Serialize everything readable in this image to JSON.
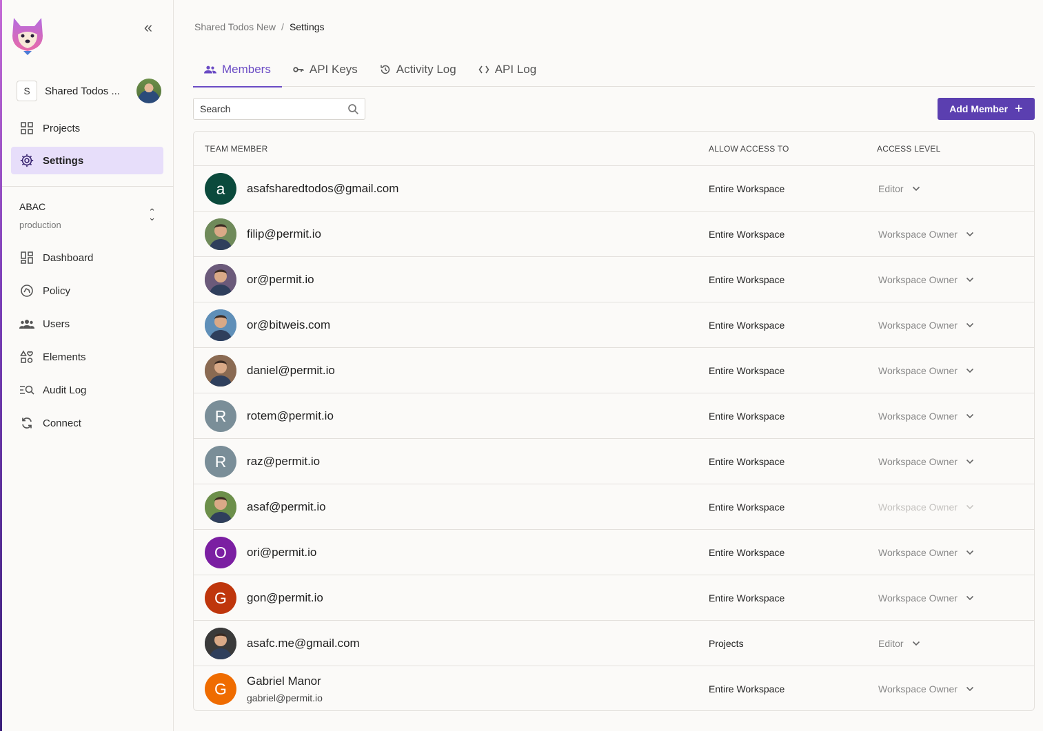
{
  "sidebar": {
    "logo": "fox-logo",
    "collapse_icon": "double-chevron-left-icon",
    "workspace": {
      "badge": "S",
      "name": "Shared Todos ..."
    },
    "top_items": [
      {
        "label": "Projects",
        "icon": "grid-icon",
        "active": false
      },
      {
        "label": "Settings",
        "icon": "gear-icon",
        "active": true
      }
    ],
    "env": {
      "name": "ABAC",
      "sub": "production"
    },
    "items": [
      {
        "label": "Dashboard",
        "icon": "dashboard-icon"
      },
      {
        "label": "Policy",
        "icon": "policy-icon"
      },
      {
        "label": "Users",
        "icon": "users-icon"
      },
      {
        "label": "Elements",
        "icon": "elements-icon"
      },
      {
        "label": "Audit Log",
        "icon": "audit-log-icon"
      },
      {
        "label": "Connect",
        "icon": "sync-icon"
      }
    ]
  },
  "breadcrumb": {
    "parent": "Shared Todos New",
    "separator": "/",
    "current": "Settings"
  },
  "tabs": [
    {
      "label": "Members",
      "icon": "members-icon",
      "active": true
    },
    {
      "label": "API Keys",
      "icon": "key-icon",
      "active": false
    },
    {
      "label": "Activity Log",
      "icon": "history-icon",
      "active": false
    },
    {
      "label": "API Log",
      "icon": "code-brackets-icon",
      "active": false
    }
  ],
  "search": {
    "placeholder": "Search"
  },
  "add_button": {
    "label": "Add Member"
  },
  "table": {
    "headers": {
      "member": "TEAM MEMBER",
      "access": "ALLOW ACCESS TO",
      "level": "ACCESS LEVEL"
    },
    "rows": [
      {
        "email": "asafsharedtodos@gmail.com",
        "initial": "a",
        "avatar_color": "#0b4a3c",
        "photo": false,
        "access": "Entire Workspace",
        "level": "Editor",
        "disabled": false
      },
      {
        "email": "filip@permit.io",
        "initial": "",
        "avatar_color": "#6f8a5a",
        "photo": true,
        "access": "Entire Workspace",
        "level": "Workspace Owner",
        "disabled": false
      },
      {
        "email": "or@permit.io",
        "initial": "",
        "avatar_color": "#6b5a7a",
        "photo": true,
        "access": "Entire Workspace",
        "level": "Workspace Owner",
        "disabled": false
      },
      {
        "email": "or@bitweis.com",
        "initial": "",
        "avatar_color": "#5f8fb8",
        "photo": true,
        "access": "Entire Workspace",
        "level": "Workspace Owner",
        "disabled": false
      },
      {
        "email": "daniel@permit.io",
        "initial": "",
        "avatar_color": "#8a6a52",
        "photo": true,
        "access": "Entire Workspace",
        "level": "Workspace Owner",
        "disabled": false
      },
      {
        "email": "rotem@permit.io",
        "initial": "R",
        "avatar_color": "#7a8e98",
        "photo": false,
        "access": "Entire Workspace",
        "level": "Workspace Owner",
        "disabled": false
      },
      {
        "email": "raz@permit.io",
        "initial": "R",
        "avatar_color": "#7a8e98",
        "photo": false,
        "access": "Entire Workspace",
        "level": "Workspace Owner",
        "disabled": false
      },
      {
        "email": "asaf@permit.io",
        "initial": "",
        "avatar_color": "#6c8f4a",
        "photo": true,
        "access": "Entire Workspace",
        "level": "Workspace Owner",
        "disabled": true
      },
      {
        "email": "ori@permit.io",
        "initial": "O",
        "avatar_color": "#7b1fa2",
        "photo": false,
        "access": "Entire Workspace",
        "level": "Workspace Owner",
        "disabled": false
      },
      {
        "email": "gon@permit.io",
        "initial": "G",
        "avatar_color": "#bf360c",
        "photo": false,
        "access": "Entire Workspace",
        "level": "Workspace Owner",
        "disabled": false
      },
      {
        "email": "asafc.me@gmail.com",
        "initial": "",
        "avatar_color": "#3a3a3a",
        "photo": true,
        "access": "Projects",
        "level": "Editor",
        "disabled": false
      },
      {
        "name": "Gabriel Manor",
        "email": "gabriel@permit.io",
        "initial": "G",
        "avatar_color": "#ef6c00",
        "photo": false,
        "access": "Entire Workspace",
        "level": "Workspace Owner",
        "disabled": false
      }
    ]
  },
  "colors": {
    "accent": "#5b3fb0",
    "active_tab": "#6a4bc4",
    "active_nav_bg": "#e7defa"
  }
}
